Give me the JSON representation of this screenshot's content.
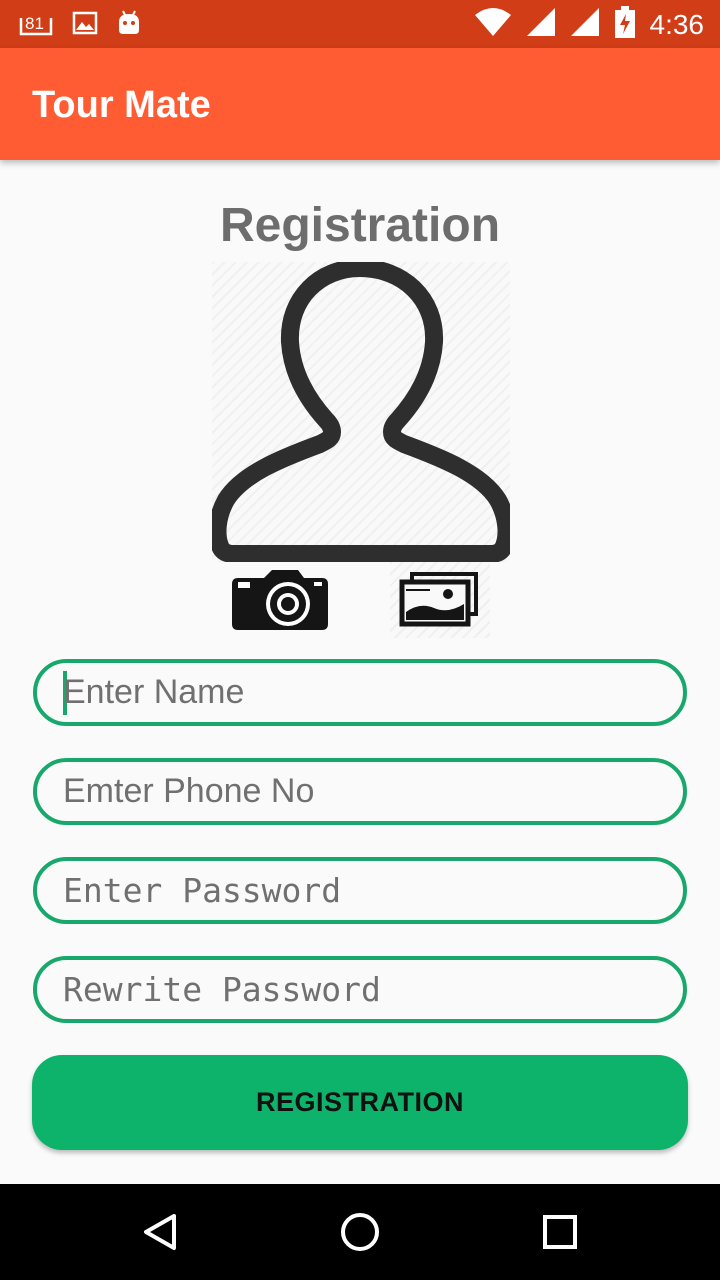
{
  "status_bar": {
    "notification_badge": "81",
    "time": "4:36",
    "icons": [
      "notification-81-icon",
      "image-icon",
      "android-icon",
      "wifi-icon",
      "signal-icon",
      "signal-icon-2",
      "battery-charging-icon"
    ]
  },
  "app_bar": {
    "title": "Tour Mate",
    "color": "#ff5c33"
  },
  "page": {
    "title": "Registration"
  },
  "photo": {
    "avatar_icon": "person-placeholder-icon",
    "camera_icon": "camera-icon",
    "gallery_icon": "gallery-icon"
  },
  "form": {
    "name_placeholder": "Enter Name",
    "phone_placeholder": "Emter Phone No",
    "password_placeholder": "Enter Password",
    "rewrite_password_placeholder": "Rewrite Password",
    "accent_color": "#18a86b"
  },
  "register_button": {
    "label": "REGISTRATION",
    "color": "#0db36b"
  },
  "nav_bar": {
    "icons": [
      "back-icon",
      "home-icon",
      "recents-icon"
    ]
  }
}
